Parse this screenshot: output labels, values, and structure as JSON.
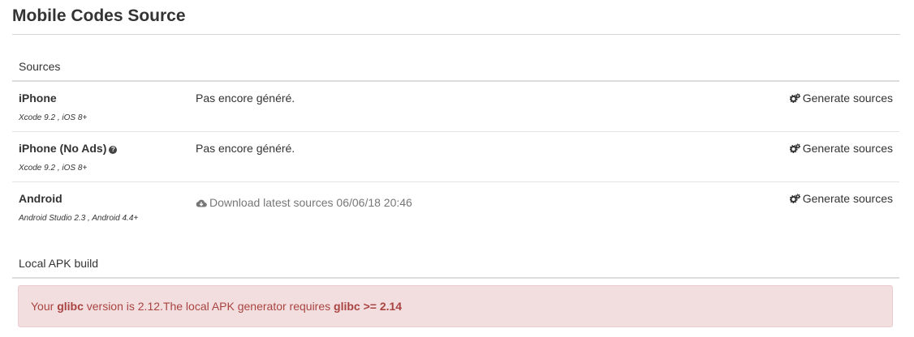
{
  "page": {
    "title": "Mobile Codes Source"
  },
  "sources": {
    "heading": "Sources",
    "rows": [
      {
        "name": "iPhone",
        "requirements": "Xcode 9.2 , iOS 8+",
        "status": "Pas encore généré.",
        "action_label": "Generate sources",
        "action_icon": "gears-icon"
      },
      {
        "name": "iPhone (No Ads)",
        "requirements": "Xcode 9.2 , iOS 8+",
        "status": "Pas encore généré.",
        "action_label": "Generate sources",
        "action_icon": "gears-icon",
        "help_icon": "question-circle-icon"
      },
      {
        "name": "Android",
        "requirements": "Android Studio 2.3 , Android 4.4+",
        "download_label": "Download latest sources 06/06/18 20:46",
        "download_icon": "cloud-download-icon",
        "action_label": "Generate sources",
        "action_icon": "gears-icon"
      }
    ]
  },
  "local_apk": {
    "heading": "Local APK build",
    "alert": {
      "prefix": "Your ",
      "lib1": "glibc",
      "middle": " version is 2.12.The local APK generator requires ",
      "requirement": "glibc >= 2.14",
      "color_text": "#a94442",
      "color_background": "#f2dede"
    }
  }
}
